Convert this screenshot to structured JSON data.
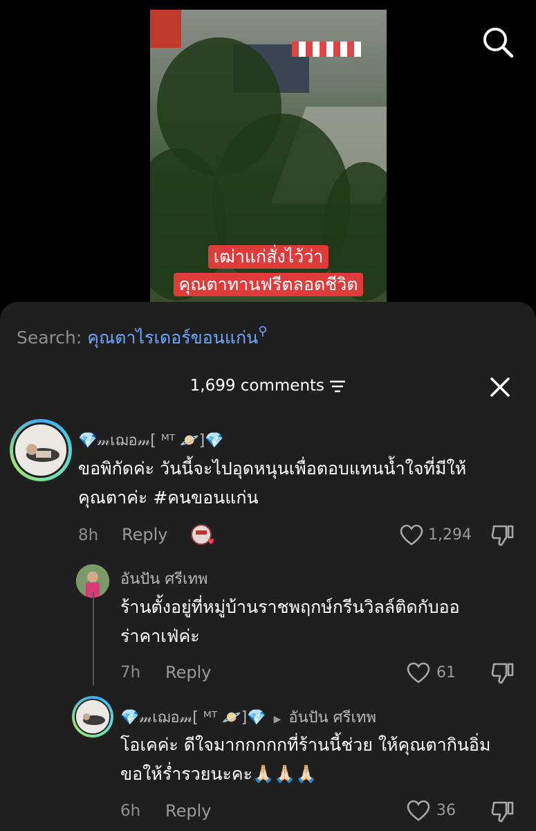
{
  "video": {
    "caption_lines": [
      "เฒ่าแก่สั่งไว้ว่า",
      "คุณตาทานฟรีตลอดชีวิต"
    ]
  },
  "sheet": {
    "search_label": "Search:",
    "search_query": "คุณตาไรเดอร์ขอนแก่น",
    "comment_count": "1,699 comments"
  },
  "comments": [
    {
      "user": "💎𝓂เฌอ𝓂[ ᴹᵀ 🪐]💎",
      "text_lines": [
        "ขอพิกัดค่ะ วันนี้จะไปอุดหนุนเพื่อตอบแทนน้ำใจที่มีให้",
        "คุณตาค่ะ #คนขอนแก่น"
      ],
      "time": "8h",
      "reply_label": "Reply",
      "likes": "1,294"
    },
    {
      "user": "อันปัน ศรีเทพ",
      "text_lines": [
        "ร้านตั้งอยู่ที่หมู่บ้านราชพฤกษ์กรีนวิลล์ติดกับออ",
        "ร่าคาเฟ่ค่ะ"
      ],
      "time": "7h",
      "reply_label": "Reply",
      "likes": "61"
    },
    {
      "user": "💎𝓂เฌอ𝓂[ ᴹᵀ 🪐]💎",
      "reply_to": "อันปัน ศรีเทพ",
      "text_lines": [
        "โอเคค่ะ ดีใจมากกกกกที่ร้านนี้ช่วย ให้คุณตากินอิ่ม",
        "ขอให้ร่ำรวยนะคะ🙏🏻🙏🏻🙏🏻"
      ],
      "time": "6h",
      "reply_label": "Reply",
      "likes": "36"
    }
  ],
  "colors": {
    "sheet_bg": "#1f1f1f",
    "link": "#6ea6ff",
    "caption_bg": "#e03b3b"
  },
  "icons": [
    "search-icon",
    "filter-icon",
    "close-icon",
    "heart-icon",
    "dislike-icon",
    "liked-by-creator-icon",
    "reply-arrow-icon"
  ]
}
